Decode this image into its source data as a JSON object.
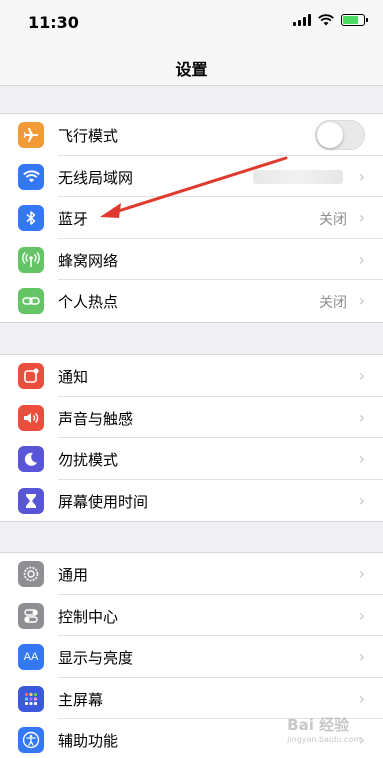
{
  "status_bar": {
    "time": "11:30",
    "battery_level": 0.8,
    "battery_color": "#4cd964"
  },
  "nav": {
    "title": "设置"
  },
  "group1": [
    {
      "label": "飞行模式",
      "icon": "airplane-icon",
      "icon_color": "#f19a37",
      "control": "toggle",
      "toggle_on": false
    },
    {
      "label": "无线局域网",
      "icon": "wifi-icon",
      "icon_color": "#3478f6",
      "control": "chevron",
      "value_blurred": true
    },
    {
      "label": "蓝牙",
      "icon": "bluetooth-icon",
      "icon_color": "#3478f6",
      "control": "chevron",
      "value": "关闭"
    },
    {
      "label": "蜂窝网络",
      "icon": "cellular-icon",
      "icon_color": "#64c466",
      "control": "chevron"
    },
    {
      "label": "个人热点",
      "icon": "hotspot-icon",
      "icon_color": "#64c466",
      "control": "chevron",
      "value": "关闭"
    }
  ],
  "group2": [
    {
      "label": "通知",
      "icon": "notifications-icon",
      "icon_color": "#eb4e3d",
      "control": "chevron"
    },
    {
      "label": "声音与触感",
      "icon": "sound-icon",
      "icon_color": "#eb4e3d",
      "control": "chevron"
    },
    {
      "label": "勿扰模式",
      "icon": "moon-icon",
      "icon_color": "#5856d6",
      "control": "chevron"
    },
    {
      "label": "屏幕使用时间",
      "icon": "hourglass-icon",
      "icon_color": "#5856d6",
      "control": "chevron"
    }
  ],
  "group3": [
    {
      "label": "通用",
      "icon": "gear-icon",
      "icon_color": "#8e8e93",
      "control": "chevron"
    },
    {
      "label": "控制中心",
      "icon": "switches-icon",
      "icon_color": "#8e8e93",
      "control": "chevron"
    },
    {
      "label": "显示与亮度",
      "icon": "display-icon",
      "icon_color": "#3478f6",
      "control": "chevron"
    },
    {
      "label": "主屏幕",
      "icon": "home-screen-icon",
      "icon_color": "#3478f6",
      "control": "chevron"
    },
    {
      "label": "辅助功能",
      "icon": "accessibility-icon",
      "icon_color": "#3478f6",
      "control": "chevron"
    }
  ],
  "annotation": {
    "arrow_color": "#e03a2f"
  },
  "watermark": {
    "text": "Bai 经验",
    "sub": "jingyan.baidu.com"
  }
}
